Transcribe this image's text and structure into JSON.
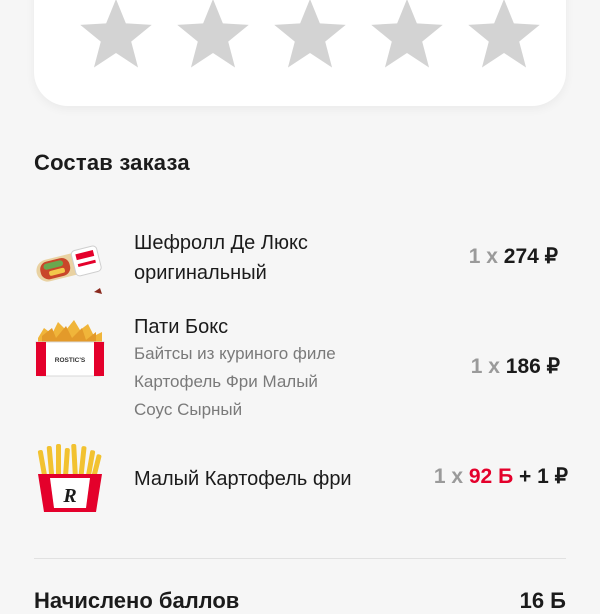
{
  "rating": {
    "stars": 5,
    "selected": 0,
    "star_color": "#d3d3d3"
  },
  "order": {
    "title": "Состав заказа",
    "items": [
      {
        "name_line1": "Шефролл Де Люкс",
        "name_line2": "оригинальный",
        "quantity": "1 х",
        "price": "274 ₽",
        "image_icon": "wrap-icon"
      },
      {
        "name_line1": "Пати Бокс",
        "sub_items": [
          "Байтсы из куриного филе",
          "Картофель Фри Малый",
          "Соус Сырный"
        ],
        "quantity": "1 х",
        "price": "186 ₽",
        "image_icon": "party-box-icon",
        "box_label": "ROSTIC'S"
      },
      {
        "name_line1": "Малый Картофель фри",
        "quantity": "1 х",
        "bonus_price": "92 Б",
        "plus_price": "+ 1 ₽",
        "image_icon": "fries-icon",
        "box_logo": "R"
      }
    ]
  },
  "bonus_row": {
    "label": "Начислено баллов",
    "value": "16 Б"
  },
  "colors": {
    "bonus": "#e4002b",
    "muted": "#7a7a7a",
    "brand_red": "#e4002b"
  }
}
